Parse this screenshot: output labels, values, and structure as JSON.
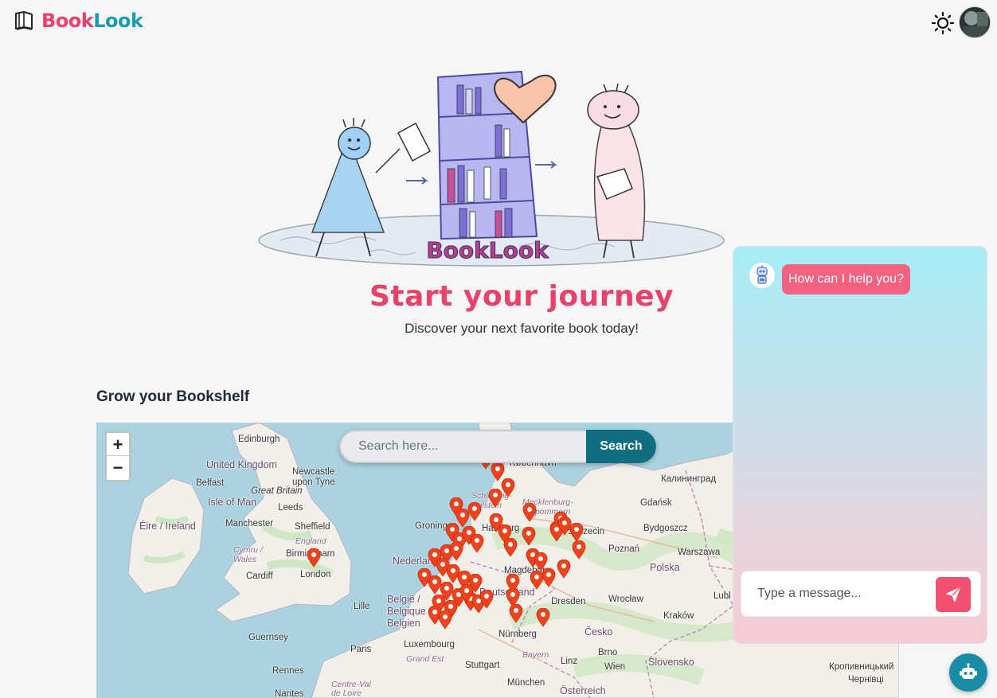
{
  "header": {
    "brand_part1": "Book",
    "brand_part2": "Look",
    "theme_icon": "sun-icon",
    "avatar_icon": "user-avatar"
  },
  "hero": {
    "illustration_text": "BookLook",
    "title": "Start your journey",
    "subtitle": "Discover your next favorite book today!"
  },
  "section": {
    "title": "Grow your Bookshelf"
  },
  "map": {
    "zoom_in": "+",
    "zoom_out": "−",
    "search_placeholder": "Search here...",
    "search_button": "Search",
    "labels": {
      "edinburgh": "Edinburgh",
      "uk": "United Kingdom",
      "newcastle": "Newcastle upon Tyne",
      "belfast": "Belfast",
      "great_britain": "Great Britain",
      "isle_of_man": "Isle of Man",
      "leeds": "Leeds",
      "eire": "Éire / Ireland",
      "manchester": "Manchester",
      "sheffield": "Sheffield",
      "england": "England",
      "cymru": "Cymru / Wales",
      "birmingham": "Birmingham",
      "cardiff": "Cardiff",
      "london": "London",
      "guernsey": "Guernsey",
      "rennes": "Rennes",
      "nantes": "Nantes",
      "lille": "Lille",
      "belgie": "België / Belgique / Belgien",
      "luxembourg": "Luxembourg",
      "grand_est": "Grand Est",
      "paris": "Paris",
      "centre": "Centre-Val de Loire",
      "nederland": "Nederland",
      "groningen": "Groningen",
      "kobenhavn": "København",
      "schleswig": "Schleswig-Holstein",
      "mecklenburg": "Mecklenburg-Vorpommern",
      "hamburg": "Hamburg",
      "szczecin": "Szczecin",
      "bydgoszcz": "Bydgoszcz",
      "gdansk": "Gdańsk",
      "kaliningrad": "Калининград",
      "poznan": "Poznań",
      "warszawa": "Warszawa",
      "polska": "Polska",
      "lublin": "Lubl",
      "magdeburg": "Magdeburg",
      "deutschland": "Deutschland",
      "dresden": "Dresden",
      "wroclaw": "Wrocław",
      "krakow": "Kraków",
      "cesko": "Česko",
      "nurnberg": "Nürnberg",
      "bayern": "Bayern",
      "stuttgart": "Stuttgart",
      "munchen": "München",
      "osterreich": "Österreich",
      "linz": "Linz",
      "wien": "Wien",
      "brno": "Brno",
      "slovensko": "Slovensko",
      "kropyvnytskyi": "Кропивницький",
      "chernivtsi": "Чернівці"
    }
  },
  "chat": {
    "bot_icon": "robot-icon",
    "greeting": "How can I help you?",
    "input_placeholder": "Type a message...",
    "send_icon": "send-icon",
    "fab_icon": "robot-icon"
  },
  "colors": {
    "brand_pink": "#e8416a",
    "brand_teal": "#1a9bb5",
    "search_button": "#0f6f80",
    "pin_red": "#f0421c",
    "chat_bubble": "#f2627f"
  }
}
